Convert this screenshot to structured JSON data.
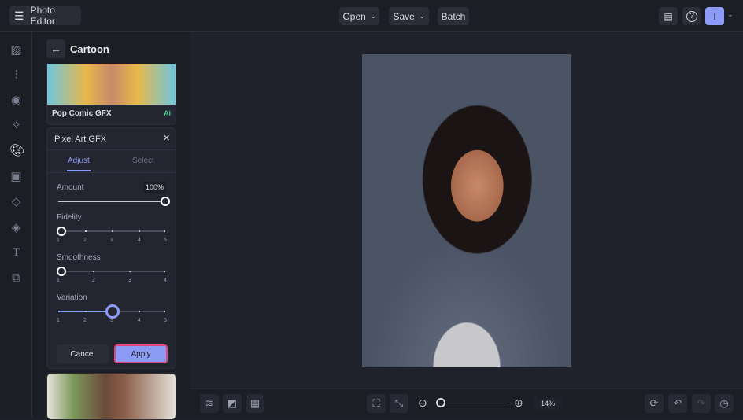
{
  "topbar": {
    "app_title": "Photo Editor",
    "open": "Open",
    "save": "Save",
    "batch": "Batch",
    "avatar_initial": "I"
  },
  "panel": {
    "title": "Cartoon",
    "preset_name": "Pop Comic GFX",
    "preset_badge": "Ai",
    "effect_title": "Pixel Art GFX",
    "tabs": [
      "Adjust",
      "Select"
    ],
    "amount": {
      "label": "Amount",
      "value": "100%",
      "fraction": 1.0
    },
    "fidelity": {
      "label": "Fidelity",
      "ticks": [
        "1",
        "2",
        "3",
        "4",
        "5"
      ],
      "value": 1
    },
    "smoothness": {
      "label": "Smoothness",
      "ticks": [
        "1",
        "2",
        "3",
        "4"
      ],
      "value": 1
    },
    "variation": {
      "label": "Variation",
      "ticks": [
        "1",
        "2",
        "3",
        "4",
        "5"
      ],
      "value": 3
    },
    "cancel": "Cancel",
    "apply": "Apply"
  },
  "bottombar": {
    "zoom": "14%",
    "zoom_fraction": 0.0
  },
  "colors": {
    "accent": "#8c9bf5",
    "apply_border": "#e0457b",
    "ai": "#3ecf8e"
  }
}
